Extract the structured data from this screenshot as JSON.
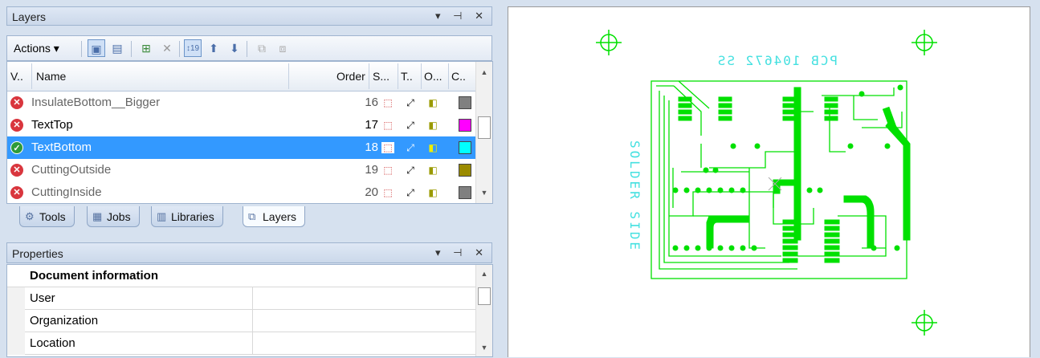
{
  "layers_panel": {
    "title": "Layers",
    "controls": "▾ ⊣ ✕",
    "toolbar": {
      "actions_label": "Actions"
    },
    "columns": {
      "visible": "V..",
      "name": "Name",
      "order": "Order",
      "s": "S...",
      "t": "T..",
      "o": "O...",
      "c": "C.."
    },
    "rows": [
      {
        "name": "InsulateBottom__Bigger",
        "order": "16",
        "status": "error",
        "color": "#808080",
        "bold": false,
        "selected": false
      },
      {
        "name": "TextTop",
        "order": "17",
        "status": "error",
        "color": "#ff00ff",
        "bold": true,
        "selected": false
      },
      {
        "name": "TextBottom",
        "order": "18",
        "status": "ok",
        "color": "#00ffff",
        "bold": true,
        "selected": true
      },
      {
        "name": "CuttingOutside",
        "order": "19",
        "status": "error",
        "color": "#9b8b00",
        "bold": false,
        "selected": false
      },
      {
        "name": "CuttingInside",
        "order": "20",
        "status": "error",
        "color": "#808080",
        "bold": false,
        "selected": false
      }
    ]
  },
  "bottom_tabs": [
    {
      "label": "Tools",
      "icon": "gear-icon"
    },
    {
      "label": "Jobs",
      "icon": "jobs-icon"
    },
    {
      "label": "Libraries",
      "icon": "libraries-icon"
    },
    {
      "label": "Layers",
      "icon": "layers-icon"
    }
  ],
  "properties_panel": {
    "title": "Properties",
    "controls": "▾ ⊣ ✕",
    "rows": [
      {
        "name": "Document information",
        "value": "",
        "category": true
      },
      {
        "name": "User",
        "value": "",
        "category": false
      },
      {
        "name": "Organization",
        "value": "",
        "category": false
      },
      {
        "name": "Location",
        "value": "",
        "category": false
      }
    ]
  },
  "canvas": {
    "top_text": "PCB 104672 SS",
    "side_text": "SOLDER SIDE",
    "trace_color": "#00e000",
    "text_color": "#44e0e0"
  }
}
